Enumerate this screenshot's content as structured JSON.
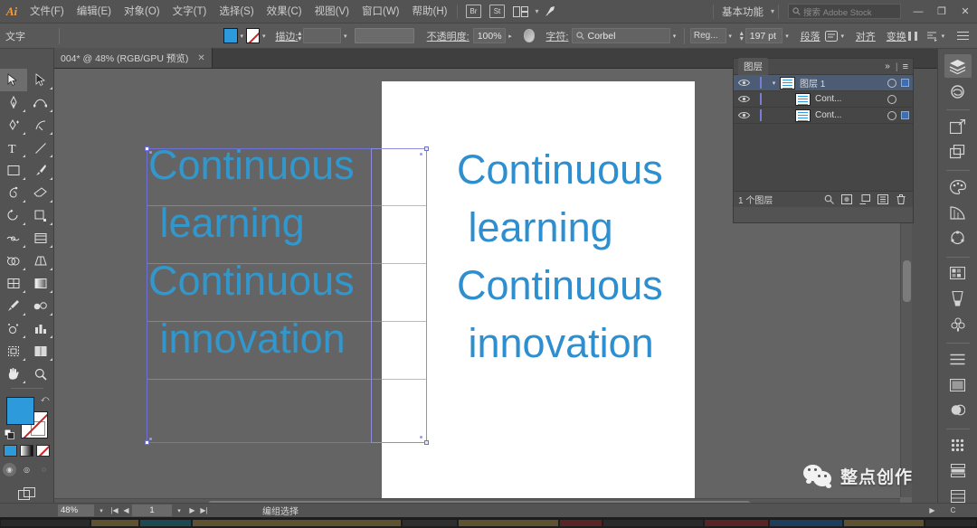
{
  "app": {
    "logo": "Ai",
    "title": "Adobe Illustrator"
  },
  "menubar": {
    "items": [
      {
        "label": "文件(F)",
        "name": "menu-file"
      },
      {
        "label": "编辑(E)",
        "name": "menu-edit"
      },
      {
        "label": "对象(O)",
        "name": "menu-object"
      },
      {
        "label": "文字(T)",
        "name": "menu-type"
      },
      {
        "label": "选择(S)",
        "name": "menu-select"
      },
      {
        "label": "效果(C)",
        "name": "menu-effect"
      },
      {
        "label": "视图(V)",
        "name": "menu-view"
      },
      {
        "label": "窗口(W)",
        "name": "menu-window"
      },
      {
        "label": "帮助(H)",
        "name": "menu-help"
      }
    ],
    "bridge_icon": "Br",
    "stock_icon": "St",
    "arrange_icon": "arrange-documents-icon",
    "rocket_icon": "rocket-icon",
    "workspace": "基本功能",
    "search_placeholder": "搜索 Adobe Stock",
    "minimize": "—",
    "restore": "❐",
    "close": "✕"
  },
  "controlbar": {
    "context_label": "文字",
    "fill_color": "#2d9bdb",
    "stroke_label": "描边:",
    "stroke_weight": "",
    "opacity_label": "不透明度:",
    "opacity_value": "100%",
    "char_label": "字符:",
    "font_family": "Corbel",
    "font_style": "Reg...",
    "font_size": "197 pt",
    "paragraph_label": "段落",
    "align_label": "对齐",
    "transform_label": "变换"
  },
  "tabbar": {
    "document_tab": "004* @ 48% (RGB/GPU 预览)",
    "close": "✕"
  },
  "toolbar": {
    "tools": [
      {
        "name": "selection-tool",
        "active": true
      },
      {
        "name": "direct-selection-tool",
        "active": false
      },
      {
        "name": "pen-tool",
        "active": false
      },
      {
        "name": "curvature-tool",
        "active": false
      },
      {
        "name": "add-anchor-point-tool",
        "active": false
      },
      {
        "name": "anchor-point-tool",
        "active": false
      },
      {
        "name": "type-tool",
        "active": false
      },
      {
        "name": "line-segment-tool",
        "active": false
      },
      {
        "name": "rectangle-tool",
        "active": false
      },
      {
        "name": "paintbrush-tool",
        "active": false
      },
      {
        "name": "shaper-tool",
        "active": false
      },
      {
        "name": "eraser-tool",
        "active": false
      },
      {
        "name": "rotate-tool",
        "active": false
      },
      {
        "name": "scale-tool",
        "active": false
      },
      {
        "name": "width-tool",
        "active": false
      },
      {
        "name": "free-transform-tool",
        "active": false
      },
      {
        "name": "shape-builder-tool",
        "active": false
      },
      {
        "name": "perspective-grid-tool",
        "active": false
      },
      {
        "name": "mesh-tool",
        "active": false
      },
      {
        "name": "gradient-tool",
        "active": false
      },
      {
        "name": "eyedropper-tool",
        "active": false
      },
      {
        "name": "blend-tool",
        "active": false
      },
      {
        "name": "symbol-sprayer-tool",
        "active": false
      },
      {
        "name": "column-graph-tool",
        "active": false
      },
      {
        "name": "artboard-tool",
        "active": false
      },
      {
        "name": "slice-tool",
        "active": false
      },
      {
        "name": "hand-tool",
        "active": false
      },
      {
        "name": "zoom-tool",
        "active": false
      }
    ],
    "fill_color": "#2d9bdb",
    "stroke_color": "none",
    "swap_icon": "swap-fill-stroke-icon",
    "default_icon": "default-fill-stroke-icon",
    "modes": [
      "color-mode",
      "gradient-mode",
      "none-mode"
    ],
    "draw_modes": [
      "draw-normal",
      "draw-behind",
      "draw-inside"
    ],
    "screen_mode": "change-screen-mode-icon"
  },
  "canvas": {
    "text_left": "Continuous\n learning\nContinuous\n innovation",
    "text_right": "Continuous\n learning\nContinuous\n innovation",
    "text_color": "#2e8fd0",
    "artboard_bg": "#ffffff",
    "selection_color": "#6f6fd8"
  },
  "layers_panel": {
    "title": "图层",
    "collapse_icon": "»",
    "menu_icon": "≡",
    "rows": [
      {
        "name": "图层 1",
        "selected": true,
        "visible": true,
        "locked": false,
        "expanded": true,
        "indent": 0,
        "has_selection": true
      },
      {
        "name": "Cont...",
        "selected": false,
        "visible": true,
        "locked": false,
        "expanded": false,
        "indent": 1,
        "has_selection": false
      },
      {
        "name": "Cont...",
        "selected": false,
        "visible": true,
        "locked": false,
        "expanded": false,
        "indent": 1,
        "has_selection": true
      }
    ],
    "footer_count": "1 个图层",
    "footer_icons": [
      "locate-object-icon",
      "make-clipping-mask-icon",
      "create-new-sublayer-icon",
      "create-new-layer-icon",
      "delete-selection-icon"
    ]
  },
  "dock": {
    "items": [
      {
        "name": "layers-panel-icon",
        "active": true
      },
      {
        "name": "libraries-panel-icon",
        "active": false
      },
      {
        "name": "artboards-panel-icon",
        "active": false
      },
      {
        "name": "asset-export-panel-icon",
        "active": false
      },
      {
        "name": "color-panel-icon",
        "active": false
      },
      {
        "name": "color-guide-panel-icon",
        "active": false
      },
      {
        "name": "recolor-artwork-icon",
        "active": false
      },
      {
        "name": "swatches-panel-icon",
        "active": false
      },
      {
        "name": "brushes-panel-icon",
        "active": false
      },
      {
        "name": "symbols-panel-icon",
        "active": false
      },
      {
        "name": "transparency-panel-icon",
        "active": false
      },
      {
        "name": "appearance-panel-icon",
        "active": false
      },
      {
        "name": "graphic-styles-panel-icon",
        "active": false
      },
      {
        "name": "align-panel-icon",
        "active": false
      },
      {
        "name": "pathfinder-panel-icon",
        "active": false
      },
      {
        "name": "transform-panel-icon",
        "active": false
      }
    ]
  },
  "statusbar": {
    "zoom": "48%",
    "page_number": "1",
    "first_icon": "|◀",
    "prev_icon": "◀",
    "next_icon": "▶",
    "last_icon": "▶|",
    "status_text": "编组选择",
    "play_icon": "▶",
    "reload_icon": "C"
  },
  "watermark": {
    "text": "整点创作",
    "icon": "wechat-icon"
  }
}
